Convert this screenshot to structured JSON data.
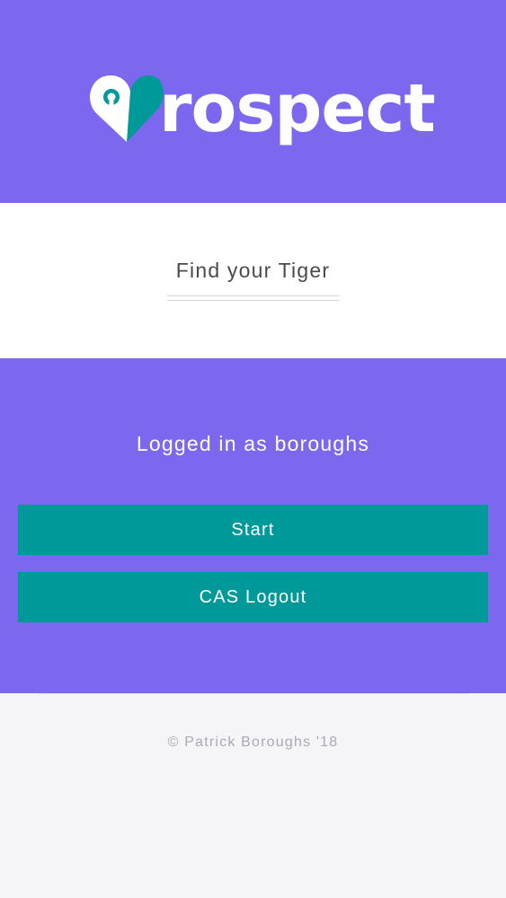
{
  "brand": {
    "logo_text": "rospect",
    "logo_icon": "heart-pin-icon",
    "colors": {
      "primary": "#7b68ee",
      "accent": "#009999",
      "white": "#ffffff"
    }
  },
  "hero": {
    "tagline": "Find your Tiger"
  },
  "session": {
    "status_text": "Logged in as boroughs"
  },
  "actions": {
    "start_label": "Start",
    "logout_label": "CAS Logout"
  },
  "footer": {
    "copyright": "© Patrick Boroughs '18"
  }
}
